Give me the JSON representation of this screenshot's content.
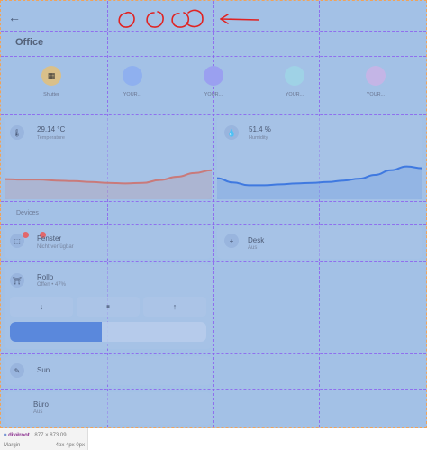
{
  "page": {
    "title": "Office"
  },
  "scenes": [
    {
      "label": "Shutter",
      "color": "#d9c08a",
      "icon": "sun-icon"
    },
    {
      "label": "YOUR...",
      "color": "#8fb0ef",
      "icon": ""
    },
    {
      "label": "YOUR...",
      "color": "#9aa0f0",
      "icon": ""
    },
    {
      "label": "YOUR...",
      "color": "#9fd2e6",
      "icon": ""
    },
    {
      "label": "YOUR...",
      "color": "#c4b5e6",
      "icon": ""
    }
  ],
  "sensors": {
    "temperature": {
      "value": "29.14 °C",
      "label": "Temperature",
      "icon": "thermometer-icon"
    },
    "humidity": {
      "value": "51.4 %",
      "label": "Humidity",
      "icon": "droplet-icon"
    }
  },
  "chart_data": [
    {
      "type": "area",
      "series": [
        {
          "values": [
            43,
            42,
            42,
            40,
            39,
            37,
            35,
            34,
            35,
            41,
            48,
            56,
            62
          ]
        }
      ],
      "color": "#c97a7a",
      "ylim": [
        0,
        100
      ]
    },
    {
      "type": "area",
      "series": [
        {
          "values": [
            45,
            36,
            30,
            30,
            32,
            34,
            35,
            37,
            40,
            44,
            52,
            62,
            70,
            66
          ]
        }
      ],
      "color": "#3f79e0",
      "ylim": [
        0,
        100
      ]
    }
  ],
  "devices": {
    "section_label": "Devices",
    "fenster": {
      "name": "Fenster",
      "status": "Nicht verfügbar"
    },
    "desk": {
      "name": "Desk",
      "status": "Aus"
    },
    "rollo": {
      "name": "Rollo",
      "status": "Offen • 47%",
      "position_percent": 47,
      "controls": {
        "down": "↓",
        "stop": "⏸",
        "up": "↑"
      }
    },
    "sun": {
      "name": "Sun"
    },
    "buero": {
      "name": "Büro",
      "status": "Aus"
    }
  },
  "inspector": {
    "tag": "div#root",
    "dims": "877 × 873.09",
    "prop": "Margin",
    "prop_value": "4px 4px 0px"
  },
  "colors": {
    "overlay": "#a3c1e6",
    "grid": "#8b5cf0",
    "accent": "#5a88dc"
  }
}
